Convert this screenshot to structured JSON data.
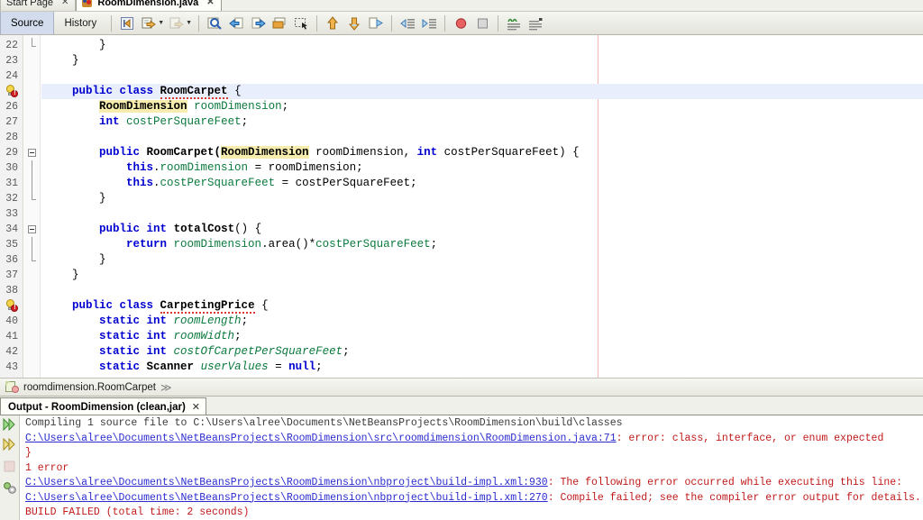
{
  "window": {
    "doc_tabs": [
      {
        "label": "Start Page",
        "close": "✕",
        "active": false,
        "icon": ""
      },
      {
        "label": "RoomDimension.java",
        "close": "✕",
        "active": true,
        "icon": "java-file-icon"
      }
    ]
  },
  "toolbar": {
    "source_label": "Source",
    "history_label": "History",
    "buttons": [
      {
        "name": "last-edit-button",
        "tooltip": "Last Edit"
      },
      {
        "name": "back-button",
        "tooltip": "Back"
      },
      {
        "name": "forward-button",
        "tooltip": "Forward"
      },
      {
        "name": "find-selection-button",
        "tooltip": "Find Selection"
      },
      {
        "name": "previous-bookmark-button",
        "tooltip": "Previous Bookmark"
      },
      {
        "name": "next-bookmark-button",
        "tooltip": "Next Bookmark"
      },
      {
        "name": "toggle-bookmark-button",
        "tooltip": "Toggle Bookmark"
      },
      {
        "name": "rectangular-selection-button",
        "tooltip": "Rectangular Selection"
      },
      {
        "name": "previous-error-button",
        "tooltip": "Previous Error"
      },
      {
        "name": "next-error-button",
        "tooltip": "Next Error"
      },
      {
        "name": "toggle-highlight-button",
        "tooltip": "Toggle Highlight"
      },
      {
        "name": "shift-left-button",
        "tooltip": "Shift Left"
      },
      {
        "name": "shift-right-button",
        "tooltip": "Shift Right"
      },
      {
        "name": "start-macro-recording-button",
        "tooltip": "Start Macro Recording"
      },
      {
        "name": "stop-macro-recording-button",
        "tooltip": "Stop Macro Recording"
      },
      {
        "name": "comment-button",
        "tooltip": "Comment"
      },
      {
        "name": "uncomment-button",
        "tooltip": "Uncomment"
      }
    ]
  },
  "editor": {
    "lines": [
      {
        "num": "22",
        "marker": "",
        "fold": "end",
        "highlight": false,
        "segments": [
          {
            "t": "        }",
            "c": "plain"
          }
        ]
      },
      {
        "num": "23",
        "marker": "",
        "fold": "",
        "highlight": false,
        "segments": [
          {
            "t": "    }",
            "c": "plain"
          }
        ]
      },
      {
        "num": "24",
        "marker": "",
        "fold": "",
        "highlight": false,
        "segments": [
          {
            "t": "",
            "c": "plain"
          }
        ]
      },
      {
        "num": "25",
        "marker": "bulb",
        "fold": "",
        "highlight": true,
        "segments": [
          {
            "t": "    ",
            "c": "plain"
          },
          {
            "t": "public class ",
            "c": "kw"
          },
          {
            "t": "RoomCarpet",
            "c": "typ squiggle"
          },
          {
            "t": " {",
            "c": "plain"
          }
        ]
      },
      {
        "num": "26",
        "marker": "",
        "fold": "",
        "highlight": false,
        "segments": [
          {
            "t": "        ",
            "c": "plain"
          },
          {
            "t": "RoomDimension",
            "c": "typ hlident"
          },
          {
            "t": " ",
            "c": "plain"
          },
          {
            "t": "roomDimension",
            "c": "fld"
          },
          {
            "t": ";",
            "c": "plain"
          }
        ]
      },
      {
        "num": "27",
        "marker": "",
        "fold": "",
        "highlight": false,
        "segments": [
          {
            "t": "        ",
            "c": "plain"
          },
          {
            "t": "int",
            "c": "kw"
          },
          {
            "t": " ",
            "c": "plain"
          },
          {
            "t": "costPerSquareFeet",
            "c": "fld"
          },
          {
            "t": ";",
            "c": "plain"
          }
        ]
      },
      {
        "num": "28",
        "marker": "",
        "fold": "",
        "highlight": false,
        "segments": [
          {
            "t": "",
            "c": "plain"
          }
        ]
      },
      {
        "num": "29",
        "marker": "",
        "fold": "start",
        "highlight": false,
        "segments": [
          {
            "t": "        ",
            "c": "plain"
          },
          {
            "t": "public ",
            "c": "kw"
          },
          {
            "t": "RoomCarpet(",
            "c": "typ"
          },
          {
            "t": "RoomDimension",
            "c": "typ hlident"
          },
          {
            "t": " roomDimension, ",
            "c": "plain"
          },
          {
            "t": "int",
            "c": "kw"
          },
          {
            "t": " costPerSquareFeet) {",
            "c": "plain"
          }
        ]
      },
      {
        "num": "30",
        "marker": "",
        "fold": "mid",
        "highlight": false,
        "segments": [
          {
            "t": "            ",
            "c": "plain"
          },
          {
            "t": "this",
            "c": "kw"
          },
          {
            "t": ".",
            "c": "plain"
          },
          {
            "t": "roomDimension",
            "c": "fld"
          },
          {
            "t": " = roomDimension;",
            "c": "plain"
          }
        ]
      },
      {
        "num": "31",
        "marker": "",
        "fold": "mid",
        "highlight": false,
        "segments": [
          {
            "t": "            ",
            "c": "plain"
          },
          {
            "t": "this",
            "c": "kw"
          },
          {
            "t": ".",
            "c": "plain"
          },
          {
            "t": "costPerSquareFeet",
            "c": "fld"
          },
          {
            "t": " = costPerSquareFeet;",
            "c": "plain"
          }
        ]
      },
      {
        "num": "32",
        "marker": "",
        "fold": "end",
        "highlight": false,
        "segments": [
          {
            "t": "        }",
            "c": "plain"
          }
        ]
      },
      {
        "num": "33",
        "marker": "",
        "fold": "",
        "highlight": false,
        "segments": [
          {
            "t": "",
            "c": "plain"
          }
        ]
      },
      {
        "num": "34",
        "marker": "",
        "fold": "start",
        "highlight": false,
        "segments": [
          {
            "t": "        ",
            "c": "plain"
          },
          {
            "t": "public ",
            "c": "kw"
          },
          {
            "t": "int",
            "c": "kw"
          },
          {
            "t": " ",
            "c": "plain"
          },
          {
            "t": "totalCost",
            "c": "typ"
          },
          {
            "t": "() {",
            "c": "plain"
          }
        ]
      },
      {
        "num": "35",
        "marker": "",
        "fold": "mid",
        "highlight": false,
        "segments": [
          {
            "t": "            ",
            "c": "plain"
          },
          {
            "t": "return ",
            "c": "kw"
          },
          {
            "t": "roomDimension",
            "c": "fld"
          },
          {
            "t": ".area()*",
            "c": "plain"
          },
          {
            "t": "costPerSquareFeet",
            "c": "fld"
          },
          {
            "t": ";",
            "c": "plain"
          }
        ]
      },
      {
        "num": "36",
        "marker": "",
        "fold": "end",
        "highlight": false,
        "segments": [
          {
            "t": "        }",
            "c": "plain"
          }
        ]
      },
      {
        "num": "37",
        "marker": "",
        "fold": "",
        "highlight": false,
        "segments": [
          {
            "t": "    }",
            "c": "plain"
          }
        ]
      },
      {
        "num": "38",
        "marker": "",
        "fold": "",
        "highlight": false,
        "segments": [
          {
            "t": "",
            "c": "plain"
          }
        ]
      },
      {
        "num": "39",
        "marker": "bulb",
        "fold": "",
        "highlight": false,
        "segments": [
          {
            "t": "    ",
            "c": "plain"
          },
          {
            "t": "public class ",
            "c": "kw"
          },
          {
            "t": "CarpetingPrice",
            "c": "typ squiggle"
          },
          {
            "t": " {",
            "c": "plain"
          }
        ]
      },
      {
        "num": "40",
        "marker": "",
        "fold": "",
        "highlight": false,
        "segments": [
          {
            "t": "        ",
            "c": "plain"
          },
          {
            "t": "static int",
            "c": "kw"
          },
          {
            "t": " ",
            "c": "plain"
          },
          {
            "t": "roomLength",
            "c": "fldi"
          },
          {
            "t": ";",
            "c": "plain"
          }
        ]
      },
      {
        "num": "41",
        "marker": "",
        "fold": "",
        "highlight": false,
        "segments": [
          {
            "t": "        ",
            "c": "plain"
          },
          {
            "t": "static int",
            "c": "kw"
          },
          {
            "t": " ",
            "c": "plain"
          },
          {
            "t": "roomWidth",
            "c": "fldi"
          },
          {
            "t": ";",
            "c": "plain"
          }
        ]
      },
      {
        "num": "42",
        "marker": "",
        "fold": "",
        "highlight": false,
        "segments": [
          {
            "t": "        ",
            "c": "plain"
          },
          {
            "t": "static int",
            "c": "kw"
          },
          {
            "t": " ",
            "c": "plain"
          },
          {
            "t": "costOfCarpetPerSquareFeet",
            "c": "fldi"
          },
          {
            "t": ";",
            "c": "plain"
          }
        ]
      },
      {
        "num": "43",
        "marker": "",
        "fold": "",
        "highlight": false,
        "segments": [
          {
            "t": "        ",
            "c": "plain"
          },
          {
            "t": "static ",
            "c": "kw"
          },
          {
            "t": "Scanner",
            "c": "typ"
          },
          {
            "t": " ",
            "c": "plain"
          },
          {
            "t": "userValues",
            "c": "fldi"
          },
          {
            "t": " = ",
            "c": "plain"
          },
          {
            "t": "null",
            "c": "kw"
          },
          {
            "t": ";",
            "c": "plain"
          }
        ]
      }
    ]
  },
  "breadcrumb": {
    "path": "roomdimension.RoomCarpet",
    "chevron": "≫"
  },
  "output": {
    "tab_title": "Output - RoomDimension (clean,jar)",
    "tab_close": "✕",
    "gutter_buttons": [
      {
        "name": "rerun-button"
      },
      {
        "name": "rerun-alternate-button"
      },
      {
        "name": "stop-button"
      },
      {
        "name": "settings-button"
      }
    ],
    "lines": [
      {
        "kind": "gray",
        "text": "Compiling 1 source file to C:\\Users\\alree\\Documents\\NetBeansProjects\\RoomDimension\\build\\classes"
      },
      {
        "kind": "mixed",
        "link": "C:\\Users\\alree\\Documents\\NetBeansProjects\\RoomDimension\\src\\roomdimension\\RoomDimension.java:71",
        "rest": ": error: class, interface, or enum expected"
      },
      {
        "kind": "err",
        "text": "}"
      },
      {
        "kind": "err",
        "text": "1 error"
      },
      {
        "kind": "mixed",
        "link": "C:\\Users\\alree\\Documents\\NetBeansProjects\\RoomDimension\\nbproject\\build-impl.xml:930",
        "rest": ": The following error occurred while executing this line:"
      },
      {
        "kind": "mixed",
        "link": "C:\\Users\\alree\\Documents\\NetBeansProjects\\RoomDimension\\nbproject\\build-impl.xml:270",
        "rest": ": Compile failed; see the compiler error output for details."
      },
      {
        "kind": "err",
        "text": "BUILD FAILED (total time: 2 seconds)"
      }
    ]
  },
  "colors": {
    "keyword": "#0000d0",
    "field": "#0b7a3e",
    "error": "#c01a1a",
    "link": "#2b2bd0",
    "highlight_line": "#e8eefb",
    "ident_highlight": "#f5ecad"
  }
}
